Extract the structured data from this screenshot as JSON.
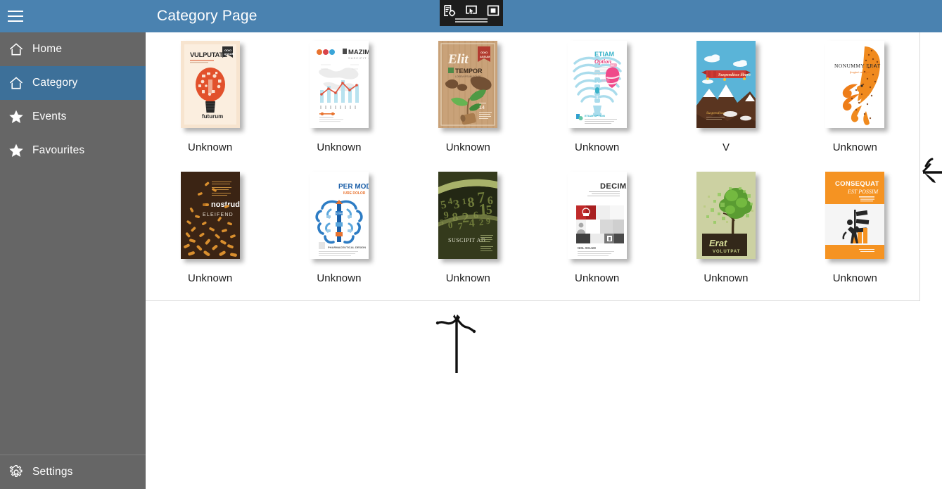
{
  "window": {
    "title": "Category Page",
    "menu_icon": "hamburger-icon"
  },
  "capture_toolbar": {
    "buttons": [
      {
        "name": "snip-region-icon",
        "label": "New snip"
      },
      {
        "name": "screen-cursor-icon",
        "label": "Window snip"
      },
      {
        "name": "nested-square-icon",
        "label": "Full screen snip"
      }
    ]
  },
  "sidebar": {
    "items": [
      {
        "label": "Home",
        "icon": "home-icon",
        "selected": false
      },
      {
        "label": "Category",
        "icon": "home-icon",
        "selected": true
      },
      {
        "label": "Events",
        "icon": "star-icon",
        "selected": false
      },
      {
        "label": "Favourites",
        "icon": "star-icon",
        "selected": false
      }
    ],
    "footer": {
      "label": "Settings",
      "icon": "gear-icon"
    }
  },
  "catalog": {
    "items": [
      {
        "label": "Unknown",
        "cover": "vulputate-bulb",
        "title": "VULPUTATE",
        "subtitle": "futurum",
        "badge": "ODIO ASSUM"
      },
      {
        "label": "Unknown",
        "cover": "mazim-chart",
        "title": "MAZIM",
        "subtitle": "SUSCIPIT QUI"
      },
      {
        "label": "Unknown",
        "cover": "elit-tempor-wood",
        "title": "Elit",
        "subtitle": "TEMPOR",
        "badge": "ODIO ASSUM"
      },
      {
        "label": "Unknown",
        "cover": "etiam-ribcage",
        "title": "ETIAM",
        "subtitle": "Option"
      },
      {
        "label": "V",
        "cover": "mountains-banner",
        "title": "Suspendisse libero"
      },
      {
        "label": "Unknown",
        "cover": "nonummy-octopus",
        "title": "NONUMMY ERAT",
        "subtitle": "feugiat suscipit"
      },
      {
        "label": "Unknown",
        "cover": "nostrud-pills",
        "title": "nostrud",
        "subtitle": "ELEIFEND"
      },
      {
        "label": "Unknown",
        "cover": "permodo-brain",
        "title": "PER MODO",
        "subtitle": "IURE DOLOR"
      },
      {
        "label": "Unknown",
        "cover": "suscipit-numbers",
        "title": "SUSCIPIT AD"
      },
      {
        "label": "Unknown",
        "cover": "decima-grid",
        "title": "DECIMA"
      },
      {
        "label": "Unknown",
        "cover": "erat-tree",
        "title": "Erat",
        "subtitle": "VOLUTPAT"
      },
      {
        "label": "Unknown",
        "cover": "consequat-signs",
        "title": "CONSEQUAT",
        "subtitle": "EST POSSIM"
      }
    ]
  },
  "annotations": [
    {
      "name": "up-arrow-annotation",
      "direction": "up"
    },
    {
      "name": "left-arrow-annotation",
      "direction": "left"
    }
  ],
  "colors": {
    "titlebar": "#4a82b0",
    "sidebar": "#666666",
    "sidebar_selected": "#3d7099",
    "content_bg": "#ffffff",
    "toolbar_bg": "#1d1d1d"
  }
}
